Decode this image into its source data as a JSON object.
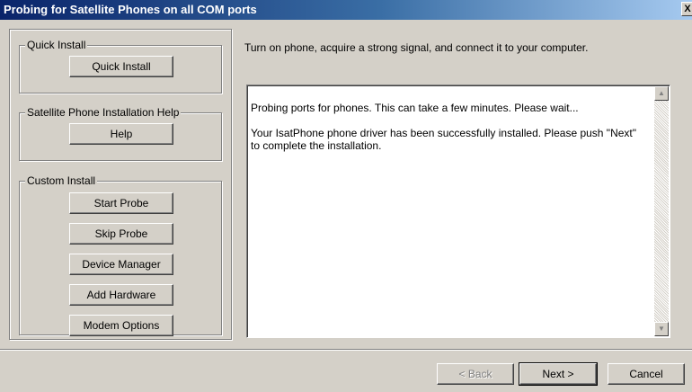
{
  "window": {
    "title": "Probing for Satellite Phones on all COM ports",
    "close_label": "X"
  },
  "quick_install": {
    "group_label": "Quick Install",
    "button_label": "Quick Install"
  },
  "help_group": {
    "group_label": "Satellite Phone Installation Help",
    "button_label": "Help"
  },
  "custom_install": {
    "group_label": "Custom Install",
    "buttons": [
      {
        "label": "Start Probe"
      },
      {
        "label": "Skip Probe"
      },
      {
        "label": "Device Manager"
      },
      {
        "label": "Add Hardware"
      },
      {
        "label": "Modem Options"
      }
    ]
  },
  "instruction": "Turn on phone,  acquire a strong signal, and connect it to your computer.",
  "log": {
    "lines": [
      "Probing ports for phones. This can take a few minutes. Please wait...",
      "Your IsatPhone phone driver has been successfully installed.  Please push \"Next\" to complete the installation."
    ]
  },
  "footer": {
    "back_label": "< Back",
    "next_label": "Next >",
    "cancel_label": "Cancel"
  }
}
